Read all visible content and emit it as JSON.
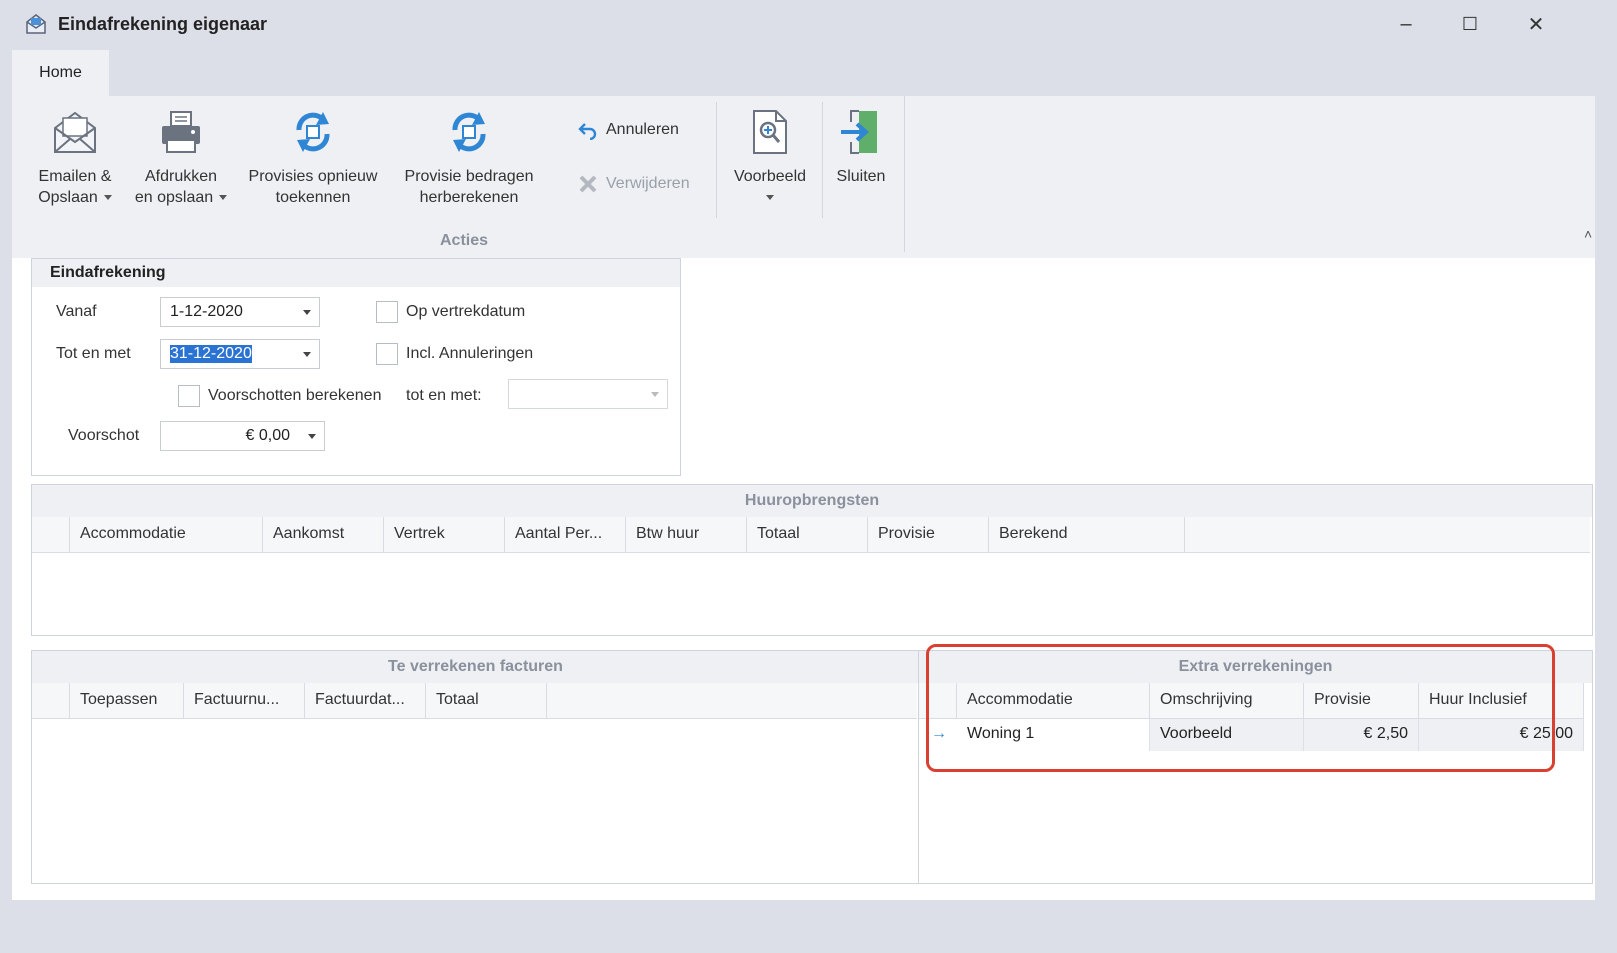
{
  "window": {
    "title": "Eindafrekening eigenaar",
    "minimize": "–",
    "maximize": "☐",
    "close": "✕"
  },
  "tabs": [
    {
      "label": "Home"
    }
  ],
  "ribbon": {
    "group_label": "Acties",
    "buttons": {
      "email_line1": "Emailen &",
      "email_line2": "Opslaan",
      "print_line1": "Afdrukken",
      "print_line2": "en opslaan",
      "prov_line1": "Provisies opnieuw",
      "prov_line2": "toekennen",
      "recalc_line1": "Provisie bedragen",
      "recalc_line2": "herberekenen",
      "cancel": "Annuleren",
      "delete": "Verwijderen",
      "preview": "Voorbeeld",
      "close": "Sluiten"
    },
    "collapse": "˄"
  },
  "settlement": {
    "header": "Eindafrekening",
    "from_label": "Vanaf",
    "from_value": "1-12-2020",
    "to_label": "Tot en met",
    "to_value": "31-12-2020",
    "departure_label": "Op vertrekdatum",
    "cancellations_label": "Incl. Annuleringen",
    "advances_label": "Voorschotten berekenen",
    "until_label": "tot en met:",
    "advance_label": "Voorschot",
    "advance_value": "€ 0,00"
  },
  "rent": {
    "header": "Huuropbrengsten",
    "columns": [
      "Accommodatie",
      "Aankomst",
      "Vertrek",
      "Aantal Per...",
      "Btw huur",
      "Totaal",
      "Provisie",
      "Berekend"
    ]
  },
  "invoices": {
    "header": "Te verrekenen facturen",
    "columns": [
      "Toepassen",
      "Factuurnu...",
      "Factuurdat...",
      "Totaal"
    ]
  },
  "extra": {
    "header": "Extra verrekeningen",
    "columns": [
      "Accommodatie",
      "Omschrijving",
      "Provisie",
      "Huur Inclusief"
    ],
    "rows": [
      {
        "accommodation": "Woning 1",
        "description": "Voorbeeld",
        "commission": "€ 2,50",
        "rent_incl": "€ 25,00"
      }
    ],
    "row_indicator": "→",
    "highlight_color": "#d9402f"
  }
}
